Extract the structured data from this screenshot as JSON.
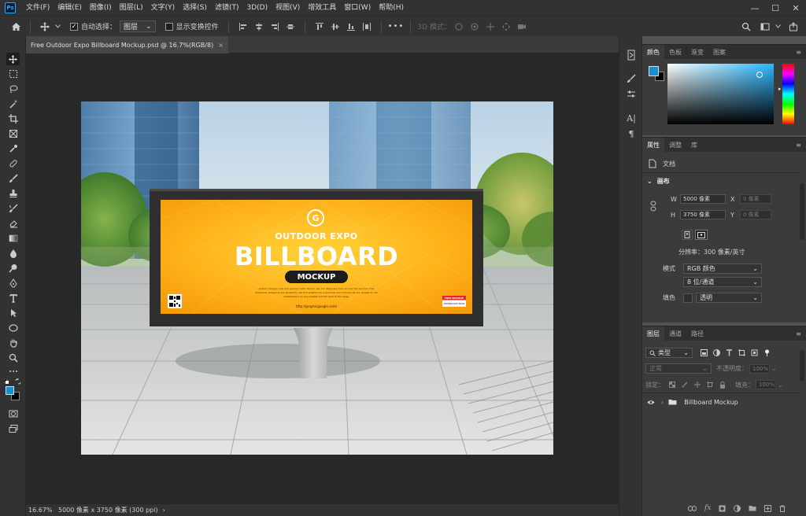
{
  "app": {
    "logo": "Ps"
  },
  "menu": [
    "文件(F)",
    "编辑(E)",
    "图像(I)",
    "图层(L)",
    "文字(Y)",
    "选择(S)",
    "滤镜(T)",
    "3D(D)",
    "视图(V)",
    "增效工具",
    "窗口(W)",
    "帮助(H)"
  ],
  "window_controls": {
    "minimize": "—",
    "maximize": "☐",
    "close": "✕"
  },
  "options_bar": {
    "auto_select_label": "自动选择：",
    "auto_select_value": "图层",
    "show_transform_label": "显示变换控件",
    "mode_3d_label": "3D 模式：",
    "more": "•••"
  },
  "document": {
    "tab_title": "Free Outdoor Expo Billboard Mockup.psd @ 16.7%(RGB/8)",
    "tab_close": "×"
  },
  "billboard": {
    "brand_mark": "G",
    "line1": "OUTDOOR EXPO",
    "line2": "BILLBOARD",
    "line3": "MOCKUP",
    "body": "Graphic Google crest and graphics with caution use. For designers from all over the world for free download. Designers are allowed to use this graphics for a personal and commercial use. Please do not redistribute it on any website but link back to this page.",
    "url": "http://graphicgoogle.com/",
    "tag_title": "FREE MOCKUP",
    "tag_sub": "DOWNLOAD NOW"
  },
  "status": {
    "zoom": "16.67%",
    "doc_info": "5000 像素 x 3750 像素 (300 ppi)",
    "arrow": "›"
  },
  "color_panel": {
    "tabs": [
      "颜色",
      "色板",
      "渐变",
      "图案"
    ],
    "foreground": "#1a8ed1",
    "background": "#000000",
    "hue": "#2bb7ff"
  },
  "properties_panel": {
    "tabs": [
      "属性",
      "调整",
      "库"
    ],
    "doc_label": "文档",
    "canvas_label": "画布",
    "w_label": "W",
    "w_value": "5000 像素",
    "x_label": "X",
    "x_placeholder": "0 像素",
    "h_label": "H",
    "h_value": "3750 像素",
    "y_label": "Y",
    "y_placeholder": "0 像素",
    "resolution": "分辨率：300 像素/英寸",
    "mode_label": "模式",
    "mode_value": "RGB 颜色",
    "depth_value": "8 位/通道",
    "fill_label": "填色",
    "fill_value": "透明"
  },
  "layers_panel": {
    "tabs": [
      "图层",
      "通道",
      "路径"
    ],
    "filter_label": "类型",
    "blend_mode": "正常",
    "opacity_label": "不透明度：",
    "opacity_value": "100%",
    "lock_label": "锁定：",
    "fill_label": "填充：",
    "fill_value": "100%",
    "layers": [
      {
        "name": "Billboard Mockup"
      }
    ]
  }
}
